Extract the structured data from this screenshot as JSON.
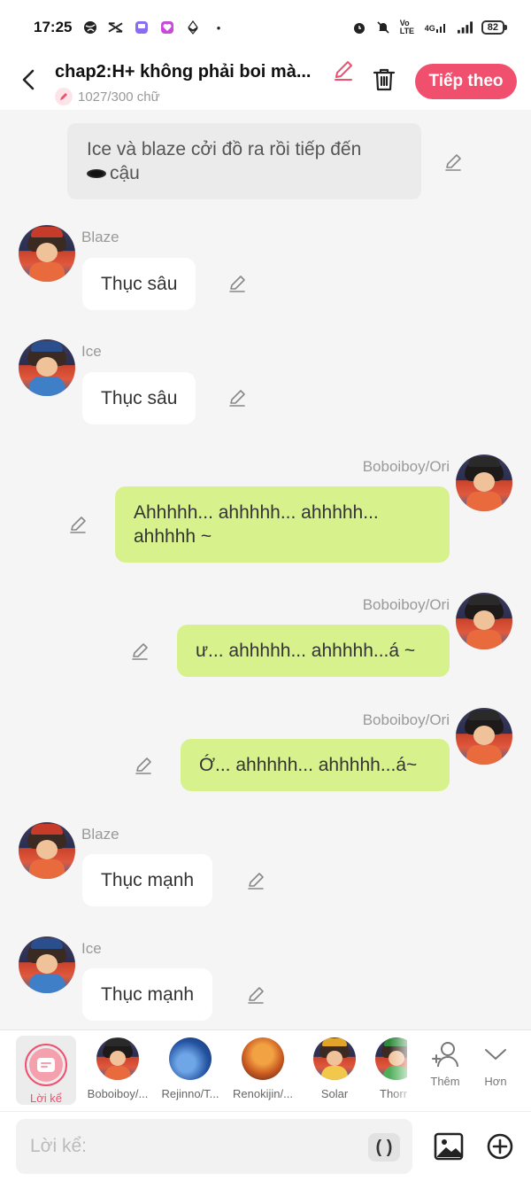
{
  "status_bar": {
    "time": "17:25",
    "network": "4G",
    "volte": "Vo LTE",
    "battery": "82"
  },
  "header": {
    "title": "chap2:H+ không phải boi mà...",
    "word_count": "1027/300 chữ",
    "next_label": "Tiếp theo"
  },
  "narration": {
    "text": "Ice và blaze cởi đồ ra rồi tiếp đến",
    "text2": "cậu"
  },
  "messages": [
    {
      "name": "Blaze",
      "text": "Thục sâu"
    },
    {
      "name": "Ice",
      "text": "Thục sâu"
    },
    {
      "name": "Boboiboy/Ori",
      "text": "Ahhhhh... ahhhhh... ahhhhh... ahhhhh ~"
    },
    {
      "name": "Boboiboy/Ori",
      "text": "ư... ahhhhh... ahhhhh...á ~"
    },
    {
      "name": "Boboiboy/Ori",
      "text": "Ớ... ahhhhh... ahhhhh...á~"
    },
    {
      "name": "Blaze",
      "text": "Thục mạnh"
    },
    {
      "name": "Ice",
      "text": "Thục mạnh"
    }
  ],
  "roster": {
    "narrator_label": "Lời kể",
    "characters": [
      "Boboiboy/...",
      "Rejinno/T...",
      "Renokijin/...",
      "Solar",
      "Thorn"
    ],
    "add_label": "Thêm",
    "more_label": "Hơn"
  },
  "composer": {
    "placeholder": "Lời kể:",
    "paren_label": "( )"
  }
}
